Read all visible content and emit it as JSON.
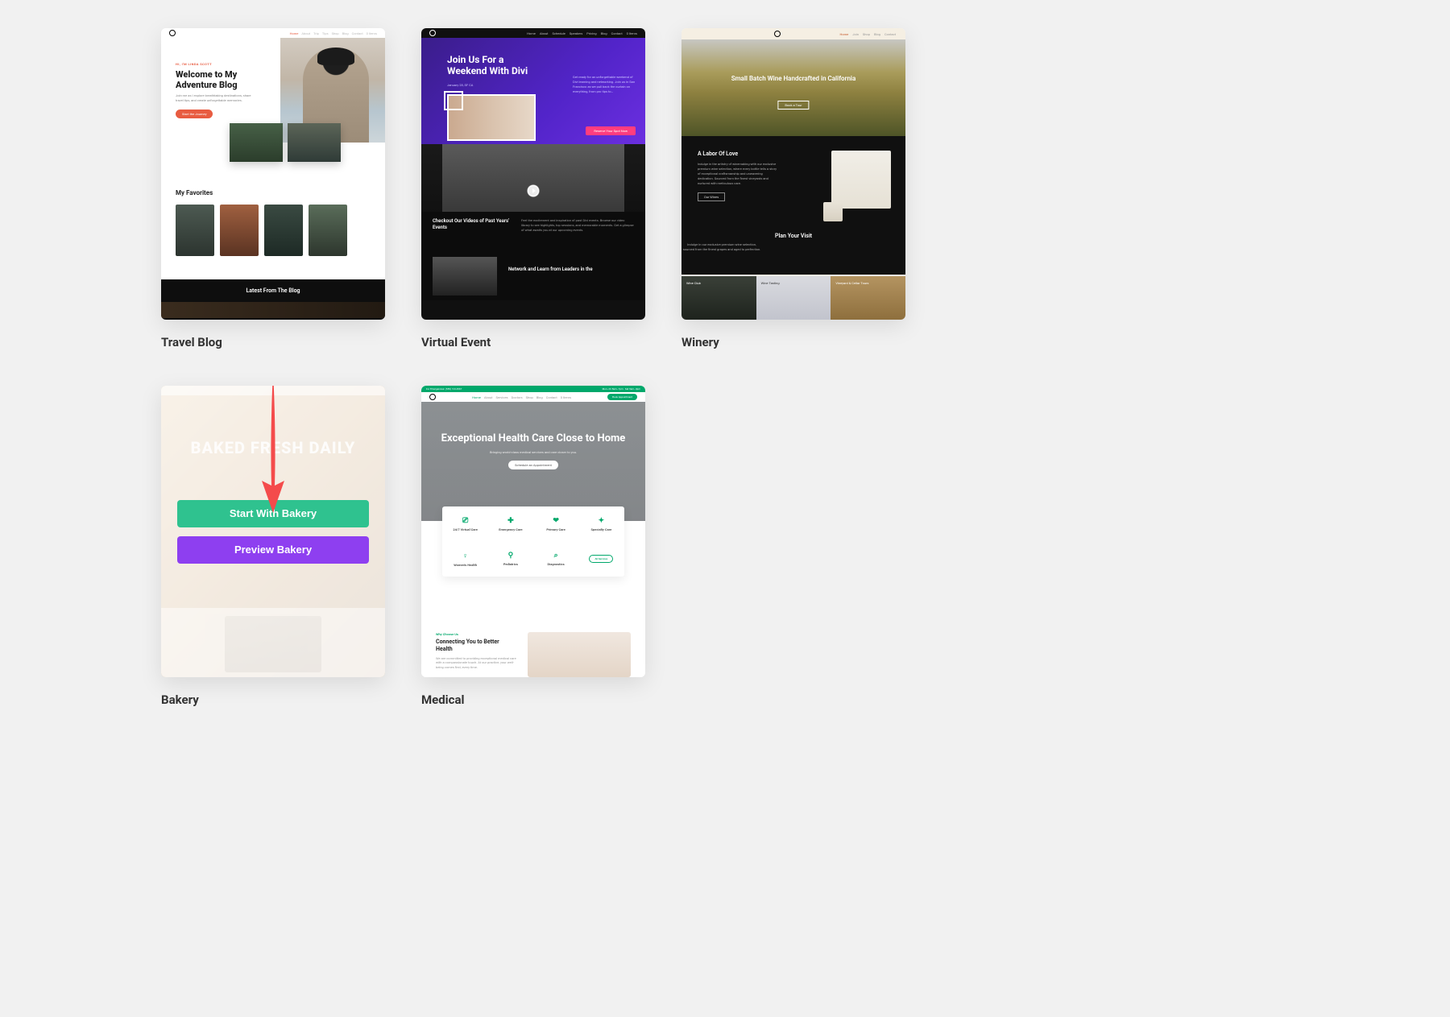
{
  "templates": {
    "travel": {
      "title": "Travel Blog",
      "nav": [
        "Home",
        "About",
        "Trip",
        "Tips",
        "Shop",
        "Blog",
        "Contact",
        "0 Items"
      ],
      "eyebrow": "HI, I'M LINDA SCOTT",
      "heading": "Welcome to My Adventure Blog",
      "sub": "Join me as I explore breathtaking destinations, share travel tips, and create unforgettable memories.",
      "favorites_title": "My Favorites",
      "latest_title": "Latest From The Blog"
    },
    "virtual": {
      "title": "Virtual Event",
      "nav": [
        "Home",
        "About",
        "Schedule",
        "Speakers",
        "Pricing",
        "Blog",
        "Contact",
        "0 Items"
      ],
      "heading": "Join Us For a Weekend With Divi",
      "date": "January 28, SF CA",
      "mid_title": "Checkout Our Videos of Past Years' Events",
      "bottom_title": "Network and Learn from Leaders in the"
    },
    "winery": {
      "title": "Winery",
      "nav": [
        "Home",
        "Join",
        "Shop",
        "Blog",
        "Contact"
      ],
      "hero": "Small Batch Wine Handcrafted in California",
      "labor_title": "A Labor Of Love",
      "plan_title": "Plan Your Visit",
      "tiles": [
        "Wine Club",
        "Wine Tasting",
        "Vineyard & Cellar Tours"
      ]
    },
    "bakery": {
      "title": "Bakery",
      "heading": "BAKED FRESH DAILY",
      "start_label": "Start With Bakery",
      "preview_label": "Preview Bakery"
    },
    "medical": {
      "title": "Medical",
      "green_left": "For Emergencies: (555) 123-4567",
      "nav": [
        "Home",
        "About",
        "Services",
        "Doctors",
        "Shop",
        "Blog",
        "Contact",
        "0 Items"
      ],
      "appt": "Book Appointment",
      "hero_h": "Exceptional Health Care Close to Home",
      "hero_p": "Bringing world-class medical services and care closer to you.",
      "hero_btn": "Schedule an Appointment",
      "cards": [
        "24/7 Virtual Care",
        "Emergency Care",
        "Primary Care",
        "Specialty Care",
        "Women's Health",
        "Pediatrics",
        "Diagnostics",
        "All Services"
      ],
      "why": "Why Choose Us",
      "connect": "Connecting You to Better Health"
    }
  }
}
